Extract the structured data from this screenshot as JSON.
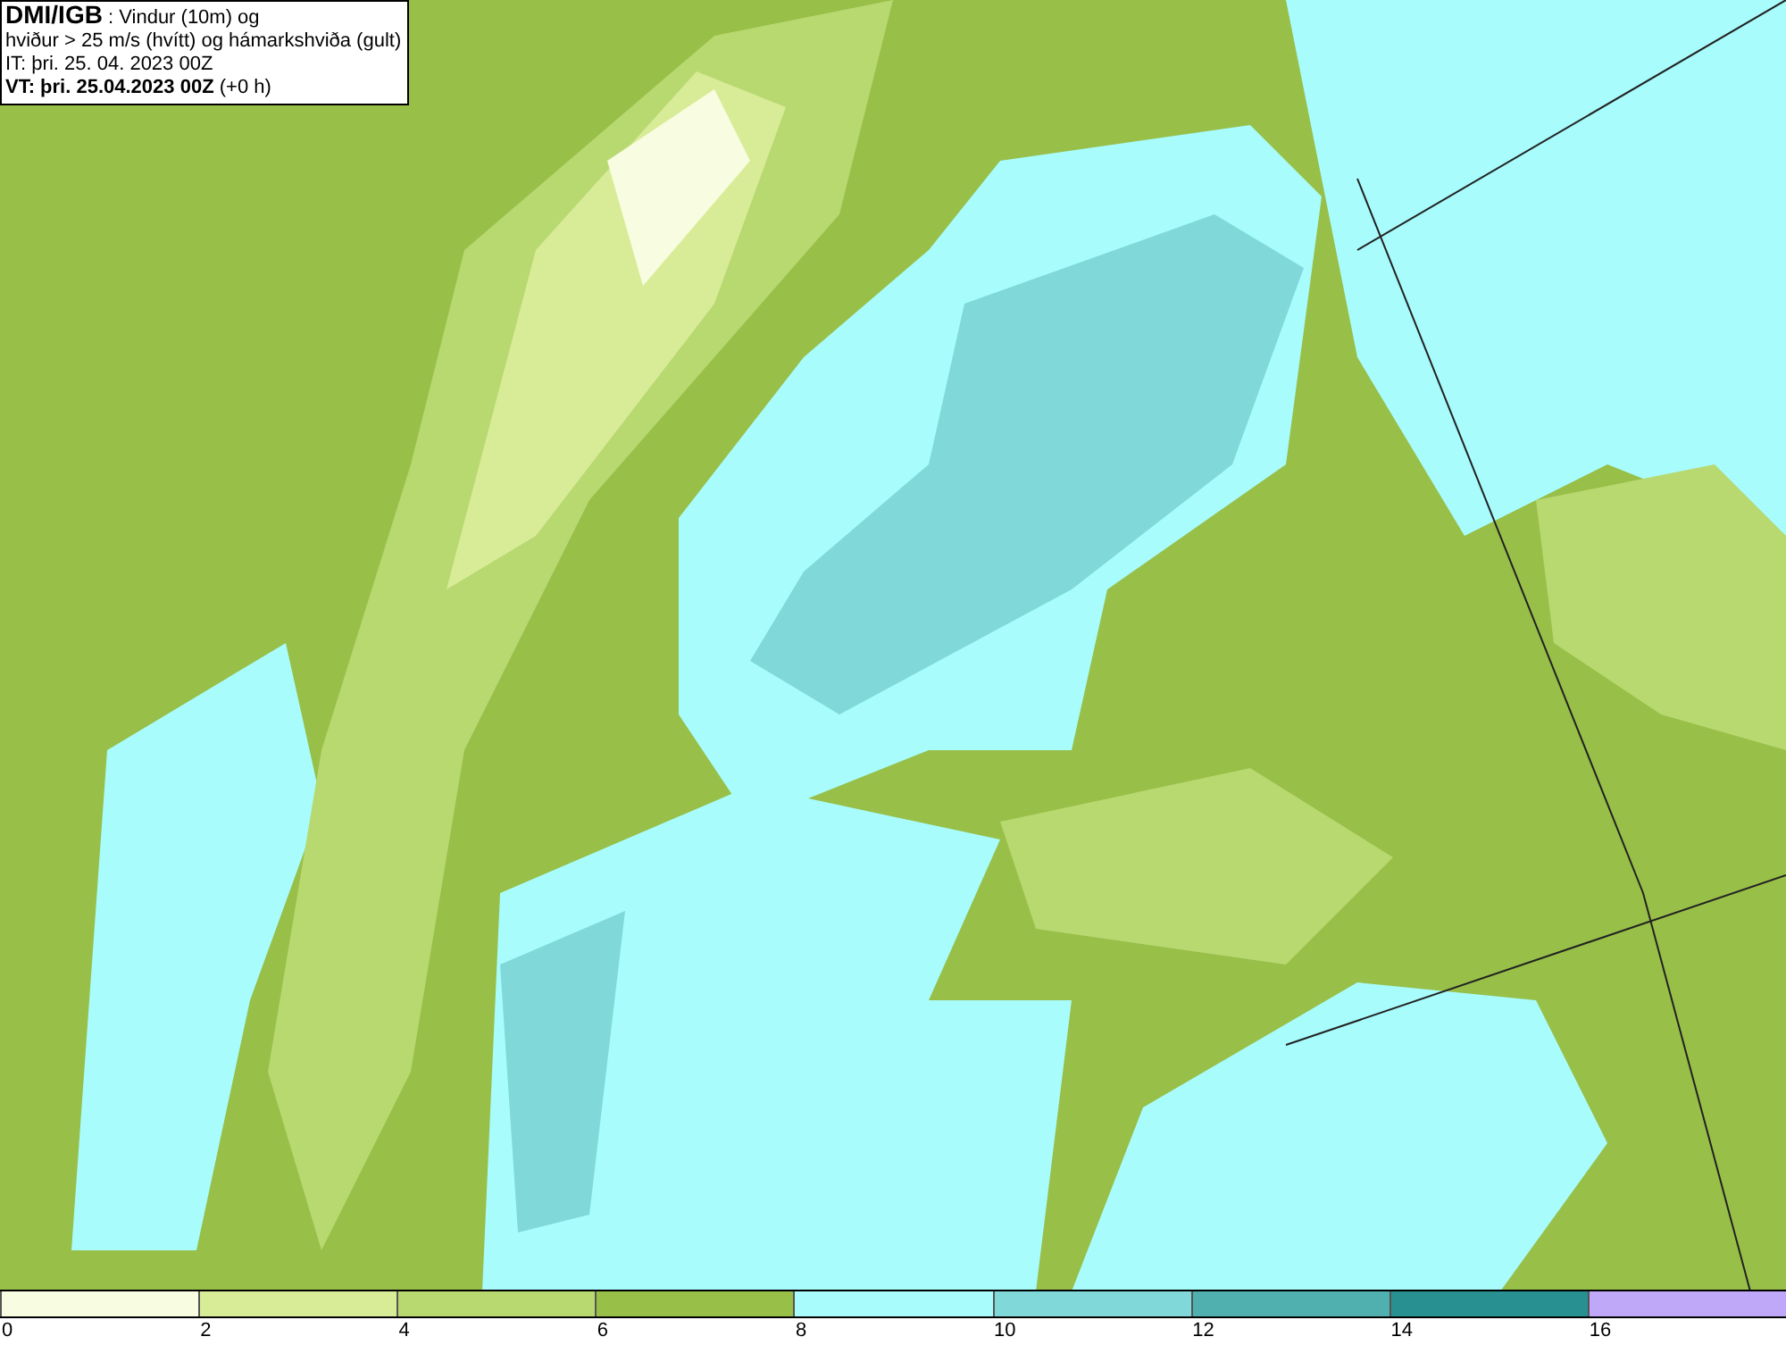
{
  "info_box": {
    "lines": [
      "**DMI/IGB** : Vindur (10m) og",
      "hviður > 25 m/s (hvítt) og hámarkshviða (gult)",
      "IT: þri. 25. 04. 2023 00Z",
      "**VT: þri. 25.04.2023 00Z** (+0 h)"
    ]
  },
  "legend": {
    "bins": [
      {
        "color": "#f8fce0",
        "tick": "0"
      },
      {
        "color": "#d8ec98",
        "tick": "2"
      },
      {
        "color": "#b8d870",
        "tick": "4"
      },
      {
        "color": "#98bf48",
        "tick": "6"
      },
      {
        "color": "#a8fcfc",
        "tick": "8"
      },
      {
        "color": "#80d8d8",
        "tick": "10"
      },
      {
        "color": "#50b0b0",
        "tick": "12"
      },
      {
        "color": "#289090",
        "tick": "14"
      },
      {
        "color": "#c0a8f8",
        "tick": "16"
      }
    ]
  }
}
